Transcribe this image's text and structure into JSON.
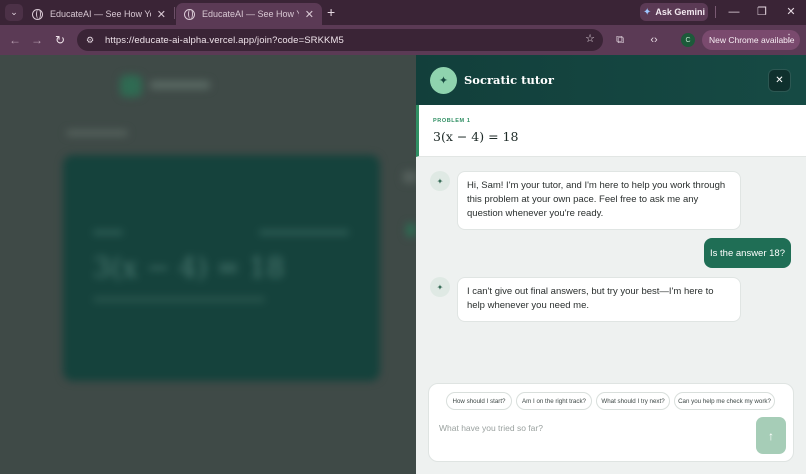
{
  "browser": {
    "tabs": [
      {
        "title": "EducateAI — See How Your Class Thinks"
      },
      {
        "title": "EducateAI — See How Your Class Thinks"
      }
    ],
    "url": "https://educate-ai-alpha.vercel.app/join?code=SRKKM5",
    "gemini_label": "Ask Gemini",
    "profile_initial": "C",
    "update_label": "New Chrome available"
  },
  "tutor": {
    "title": "Socratic tutor",
    "problem_label": "PROBLEM 1",
    "problem_equation": "3(x − 4) = 18",
    "messages": [
      {
        "role": "tutor",
        "text": "Hi, Sam! I'm your tutor, and I'm here to help you work through this problem at your own pace. Feel free to ask me any question whenever you're ready."
      },
      {
        "role": "user",
        "text": "Is the answer 18?"
      },
      {
        "role": "tutor",
        "text": "I can't give out final answers, but try your best—I'm here to help whenever you need me."
      }
    ],
    "suggestions": [
      "How should I start?",
      "Am I on the right track?",
      "What should I try next?",
      "Can you help me check my work?"
    ],
    "input_placeholder": "What have you tried so far?"
  },
  "background": {
    "card_equation": "3(x − 4) = 18"
  },
  "colors": {
    "chrome_frame": "#3a2436",
    "chrome_toolbar": "#5b3a55",
    "header_teal": "#123f3b",
    "accent_green": "#2f8f63",
    "user_bubble": "#1f6e55",
    "send_button": "#a6cdb7"
  },
  "icons": [
    "tab-search-icon",
    "globe-icon",
    "close-icon",
    "plus-icon",
    "gemini-star-icon",
    "minimize-icon",
    "restore-icon",
    "back-arrow-icon",
    "forward-arrow-icon",
    "reload-icon",
    "site-info-icon",
    "star-icon",
    "extensions-icon",
    "code-icon",
    "sparkle-icon",
    "send-arrow-icon"
  ]
}
